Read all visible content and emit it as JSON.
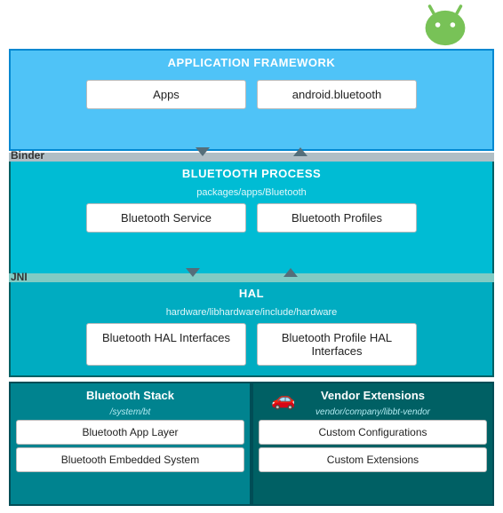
{
  "android_icon": {
    "alt": "Android Robot"
  },
  "app_framework": {
    "title": "APPLICATION FRAMEWORK",
    "boxes": [
      {
        "label": "Apps"
      },
      {
        "label": "android.bluetooth"
      }
    ]
  },
  "binder": {
    "label": "Binder"
  },
  "bt_process": {
    "title": "BLUETOOTH PROCESS",
    "sub_label": "packages/apps/Bluetooth",
    "boxes": [
      {
        "label": "Bluetooth Service"
      },
      {
        "label": "Bluetooth Profiles"
      }
    ]
  },
  "jni": {
    "label": "JNI"
  },
  "hal": {
    "title": "HAL",
    "sub_label": "hardware/libhardware/include/hardware",
    "boxes": [
      {
        "label": "Bluetooth HAL Interfaces"
      },
      {
        "label": "Bluetooth Profile HAL Interfaces"
      }
    ]
  },
  "bt_stack": {
    "title": "Bluetooth Stack",
    "sub_label": "/system/bt",
    "boxes": [
      {
        "label": "Bluetooth App Layer"
      },
      {
        "label": "Bluetooth Embedded System"
      }
    ]
  },
  "vendor_ext": {
    "title": "Vendor Extensions",
    "sub_label": "vendor/company/libbt-vendor",
    "boxes": [
      {
        "label": "Custom Configurations"
      },
      {
        "label": "Custom Extensions"
      }
    ]
  }
}
